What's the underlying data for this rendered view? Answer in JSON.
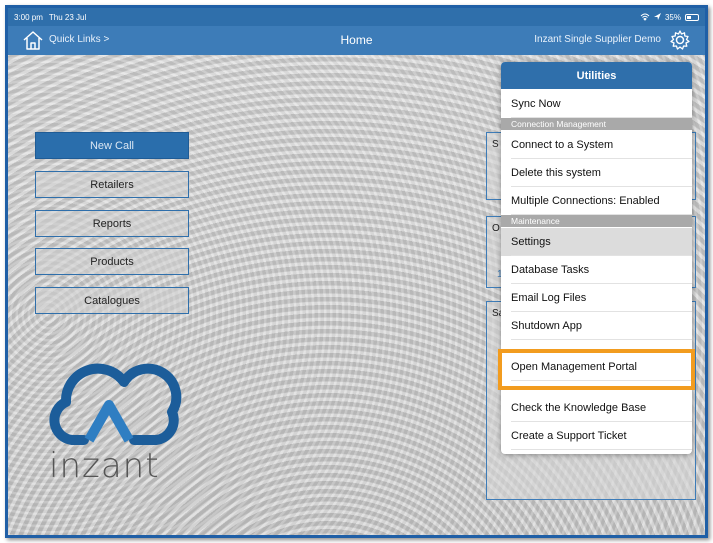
{
  "status_bar": {
    "time": "3:00 pm",
    "date": "Thu 23 Jul",
    "battery": "35%"
  },
  "nav": {
    "quick_links": "Quick Links >",
    "title": "Home",
    "subtitle": "Inzant Single Supplier Demo"
  },
  "menu": [
    {
      "label": "New Call"
    },
    {
      "label": "Retailers"
    },
    {
      "label": "Reports"
    },
    {
      "label": "Products"
    },
    {
      "label": "Catalogues"
    }
  ],
  "logo": {
    "text": "inzant"
  },
  "side_panels": [
    {
      "title": "S",
      "value": ""
    },
    {
      "title": "O",
      "value": "1"
    },
    {
      "title": "Sa",
      "value": ""
    }
  ],
  "popup": {
    "title": "Utilities",
    "sync": "Sync Now",
    "section_connection": "Connection Management",
    "connect": "Connect to a System",
    "delete": "Delete this system",
    "multiple": "Multiple Connections: Enabled",
    "section_maintenance": "Maintenance",
    "settings": "Settings",
    "database": "Database Tasks",
    "email_logs": "Email Log Files",
    "shutdown": "Shutdown App",
    "portal": "Open Management Portal",
    "knowledge": "Check the Knowledge Base",
    "ticket": "Create a Support Ticket"
  },
  "colors": {
    "brand": "#2f6fab",
    "highlight": "#f29c1f"
  }
}
